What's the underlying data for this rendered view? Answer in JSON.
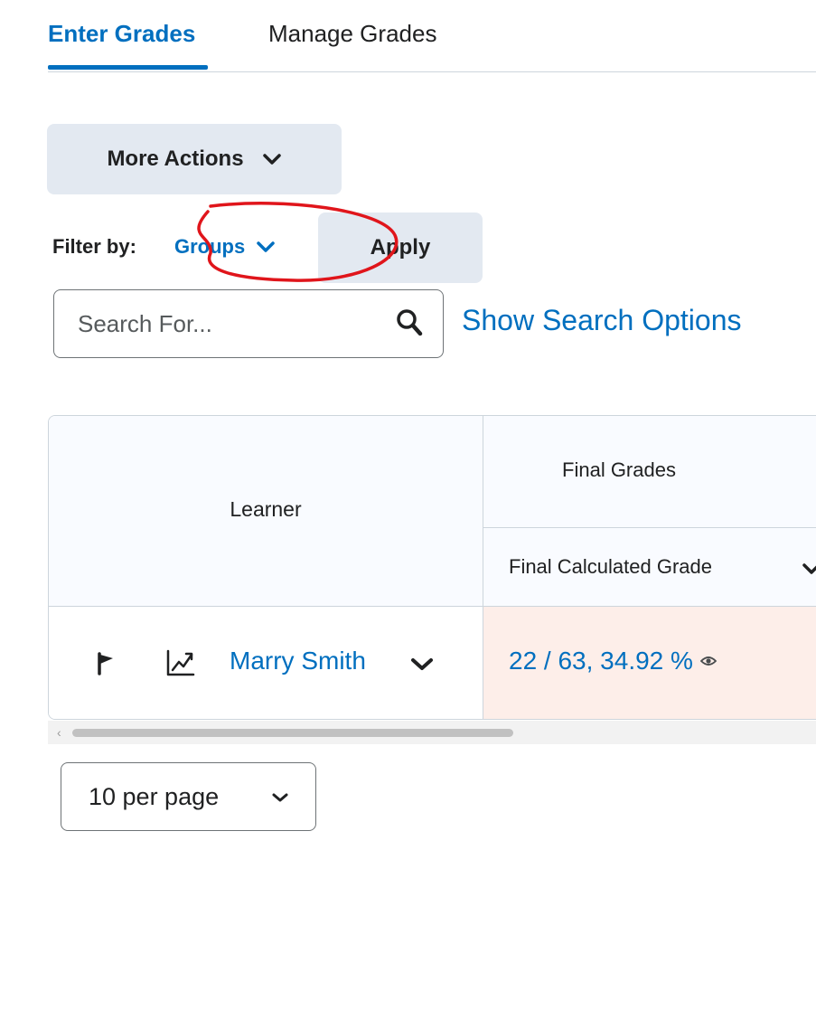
{
  "tabs": [
    {
      "label": "Enter Grades",
      "active": true
    },
    {
      "label": "Manage Grades",
      "active": false
    }
  ],
  "toolbar": {
    "more_actions": "More Actions"
  },
  "filter": {
    "label": "Filter by:",
    "groups": "Groups",
    "apply": "Apply"
  },
  "search": {
    "placeholder": "Search For...",
    "value": "",
    "show_options": "Show Search Options"
  },
  "table": {
    "col_learner": "Learner",
    "col_group": "Final Grades",
    "col_final_calc": "Final Calculated Grade",
    "rows": [
      {
        "name": "Marry Smith",
        "grade": "22 / 63, 34.92 %"
      }
    ]
  },
  "pagination": {
    "per_page": "10 per page"
  },
  "colors": {
    "accent": "#006fbf",
    "highlight": "#e0151b",
    "grade_cell_bg": "#fdeee9"
  }
}
